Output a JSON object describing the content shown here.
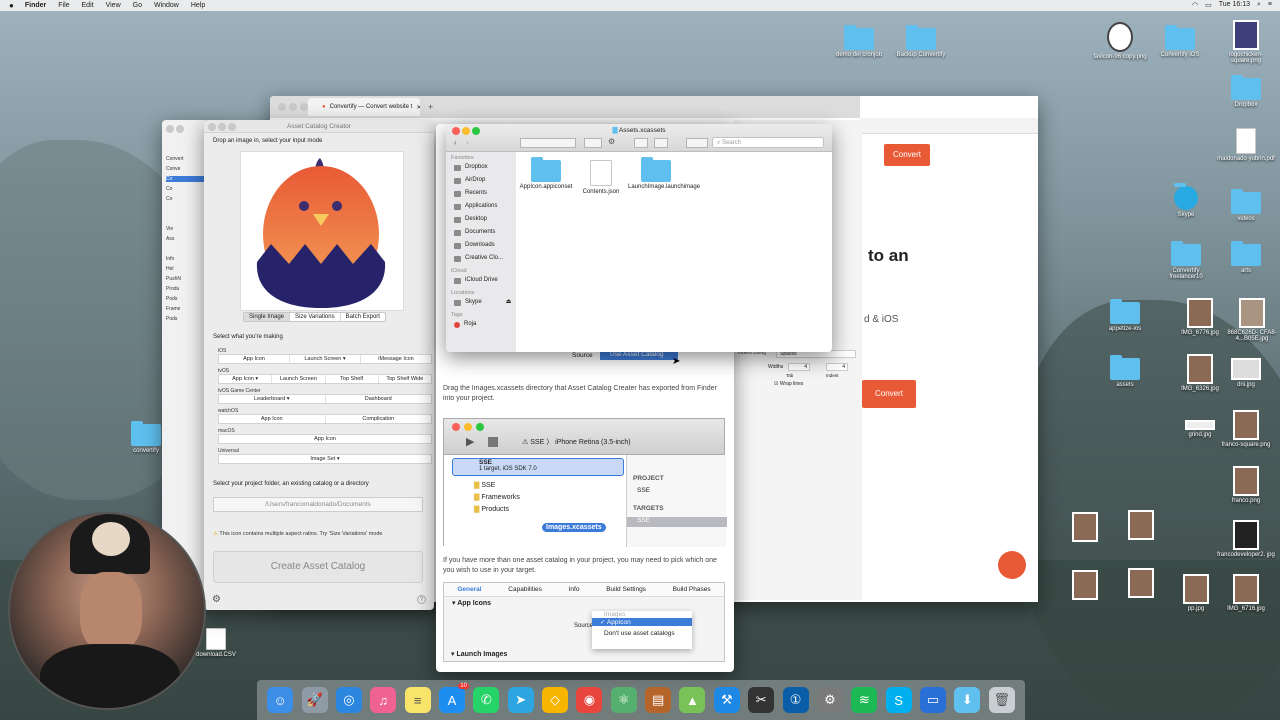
{
  "menubar": {
    "app": "Finder",
    "items": [
      "File",
      "Edit",
      "View",
      "Go",
      "Window",
      "Help"
    ],
    "clock": "Tue 16:13"
  },
  "desktop_icons": [
    {
      "label": "demo del cronjob",
      "kind": "folder"
    },
    {
      "label": "Backup Convertify",
      "kind": "folder"
    },
    {
      "label": "favicon-96\ncopy.png",
      "kind": "image"
    },
    {
      "label": "Convertify iOS",
      "kind": "folder"
    },
    {
      "label": "logochicken-\nsquare.png",
      "kind": "image"
    },
    {
      "label": "Dropbox",
      "kind": "folder"
    },
    {
      "label": "maldonado\nyubrin.pdf",
      "kind": "file"
    },
    {
      "label": "Skype",
      "kind": "app"
    },
    {
      "label": "videos",
      "kind": "folder"
    },
    {
      "label": "Convertify\nfreelancer10",
      "kind": "folder"
    },
    {
      "label": "arts",
      "kind": "folder"
    },
    {
      "label": "appetize-ios",
      "kind": "folder"
    },
    {
      "label": "IMG_6776.jpg",
      "kind": "image"
    },
    {
      "label": "868C626D-\nCFA8-4...B05E.jpg",
      "kind": "image"
    },
    {
      "label": "assets",
      "kind": "folder"
    },
    {
      "label": "IMG_6326.jpg",
      "kind": "image"
    },
    {
      "label": "dni.jpg",
      "kind": "image"
    },
    {
      "label": "grind.jpg",
      "kind": "image"
    },
    {
      "label": "franco-square.png",
      "kind": "image"
    },
    {
      "label": "franco.png",
      "kind": "image"
    },
    {
      "label": "francodeveloper2.\njpg",
      "kind": "image"
    },
    {
      "label": "pp.jpg",
      "kind": "image"
    },
    {
      "label": "IMG_6716.jpg",
      "kind": "image"
    },
    {
      "label": "convertify",
      "kind": "folder"
    },
    {
      "label": "download.CSV",
      "kind": "file"
    }
  ],
  "browser": {
    "tab_title": "Convertify — Convert website t",
    "convert_label": "Convert",
    "headline_fragment": "to an",
    "sub_fragment": "d & iOS"
  },
  "asset_catalog_creator": {
    "title": "Asset Catalog Creator",
    "drop_label": "Drop an image in, select your input mode",
    "modes": [
      "Single Image",
      "Size Variations",
      "Batch Export"
    ],
    "select_label": "Select what you're making",
    "platforms": [
      {
        "name": "iOS",
        "buttons": [
          "App Icon",
          "Launch Screen ▾",
          "iMessage Icon"
        ]
      },
      {
        "name": "tvOS",
        "buttons": [
          "App Icon ▾",
          "Launch Screen",
          "Top Shelf",
          "Top Shelf Wide"
        ]
      },
      {
        "name": "tvOS Game Center",
        "buttons": [
          "Leaderboard ▾",
          "Dashboard"
        ]
      },
      {
        "name": "watchOS",
        "buttons": [
          "App Icon",
          "Complication"
        ]
      },
      {
        "name": "macOS",
        "buttons": [
          "App Icon"
        ]
      },
      {
        "name": "Universal",
        "buttons": [
          "Image Set ▾"
        ]
      }
    ],
    "project_label": "Select your project folder, an existing catalog or a directory",
    "path_value": "/Users/francomaldonado/Documents",
    "warning": "This icon contains multiple aspect ratios. Try 'Size Variations' mode",
    "create_label": "Create Asset Catalog"
  },
  "finder": {
    "title": "Assets.xcassets",
    "search_placeholder": "Search",
    "favorites_header": "Favorites",
    "favorites": [
      "Dropbox",
      "AirDrop",
      "Recents",
      "Applications",
      "Desktop",
      "Documents",
      "Downloads",
      "Creative Clo..."
    ],
    "icloud_header": "iCloud",
    "icloud": [
      "iCloud Drive"
    ],
    "locations_header": "Locations",
    "locations": [
      "Skype"
    ],
    "tags_header": "Tags",
    "tags": [
      "Roja"
    ],
    "items": [
      {
        "name": "AppIcon.appiconset",
        "kind": "folder"
      },
      {
        "name": "Contents.json",
        "kind": "file"
      },
      {
        "name": "LaunchImage.launchimage",
        "kind": "folder"
      }
    ]
  },
  "docs": {
    "source_label": "Source",
    "source_value": "Use Asset Catalog",
    "paragraph1": "Drag the Images.xcassets directory that Asset Catalog Creater has exported from Finder into your project.",
    "xcode_scheme": "SSE",
    "xcode_device": "iPhone Retina (3.5-inch)",
    "xcode_tree": [
      "SSE",
      "1 target, iOS SDK 7.0",
      "SSE",
      "Frameworks",
      "Products"
    ],
    "xcode_project_hdr": "PROJECT",
    "xcode_project": "SSE",
    "xcode_targets_hdr": "TARGETS",
    "xcode_target": "SSE",
    "drag_label": "Images.xcassets",
    "paragraph2": "If you have more than one asset catalog in your project, you may need to pick which one you wish to use in your target.",
    "tabs": [
      "General",
      "Capabilities",
      "Info",
      "Build Settings",
      "Build Phases"
    ],
    "app_icons": "App Icons",
    "source2": "Source",
    "menu_header": "Images",
    "menu_selected": "✓ AppIcon",
    "menu_other": "Don't use asset catalogs",
    "launch_images": "Launch Images"
  },
  "editor_panel": {
    "indent_label": "Indent Using",
    "indent_value": "Spaces",
    "widths_label": "Widths",
    "tab_val": "4",
    "indent_val": "4",
    "tab_label": "Tab",
    "indent_sub": "Indent",
    "wrap": "Wrap lines"
  },
  "xcode_left": [
    "Convert",
    "Conve",
    "Co",
    "Co",
    "Co",
    "Vie",
    "Ass",
    "Info",
    "Hel",
    "Produ",
    "PushN",
    "Pods",
    "Frame",
    "Pods"
  ],
  "colors": {
    "accent": "#e85a35",
    "finder_folder": "#5fc0ef",
    "selection": "#3d7bd9"
  },
  "dock_icons": [
    "finder-icon",
    "launchpad-icon",
    "safari-icon",
    "itunes-icon",
    "notes-icon",
    "appstore-icon",
    "whatsapp-icon",
    "telegram-icon",
    "sketch-icon",
    "chrome-icon",
    "atom-icon",
    "filezilla-icon",
    "android-studio-icon",
    "xcode-icon",
    "final-cut-icon",
    "1password-icon",
    "system-prefs-icon",
    "spotify-icon",
    "skype-icon",
    "simulator-icon",
    "downloads-icon",
    "trash-icon"
  ],
  "dock_badge": "10"
}
